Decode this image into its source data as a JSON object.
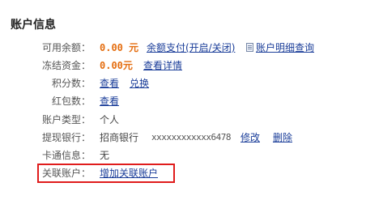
{
  "title": "账户信息",
  "rows": {
    "available": {
      "label": "可用余额：",
      "amount": "0.00 元",
      "link1": "余额支付(开启/关闭)",
      "link2": "账户明细查询"
    },
    "frozen": {
      "label": "冻结资金：",
      "amount": "0.00元",
      "link": "查看详情"
    },
    "points": {
      "label": "积分数：",
      "link1": "查看",
      "link2": "兑换"
    },
    "redpacket": {
      "label": "红包数：",
      "link": "查看"
    },
    "account_type": {
      "label": "账户类型：",
      "value": "个人"
    },
    "bank": {
      "label": "提现银行：",
      "bank_name": "招商银行",
      "card": "xxxxxxxxxxxx6478",
      "edit": "修改",
      "delete": "删除"
    },
    "card_info": {
      "label": "卡通信息：",
      "value": "无"
    },
    "linked": {
      "label": "关联账户：",
      "link": "增加关联账户"
    }
  },
  "colors": {
    "amount": "#e46d0f",
    "link": "#1a3d99",
    "highlight": "#e01c1c"
  },
  "icons": [
    "document-icon"
  ]
}
